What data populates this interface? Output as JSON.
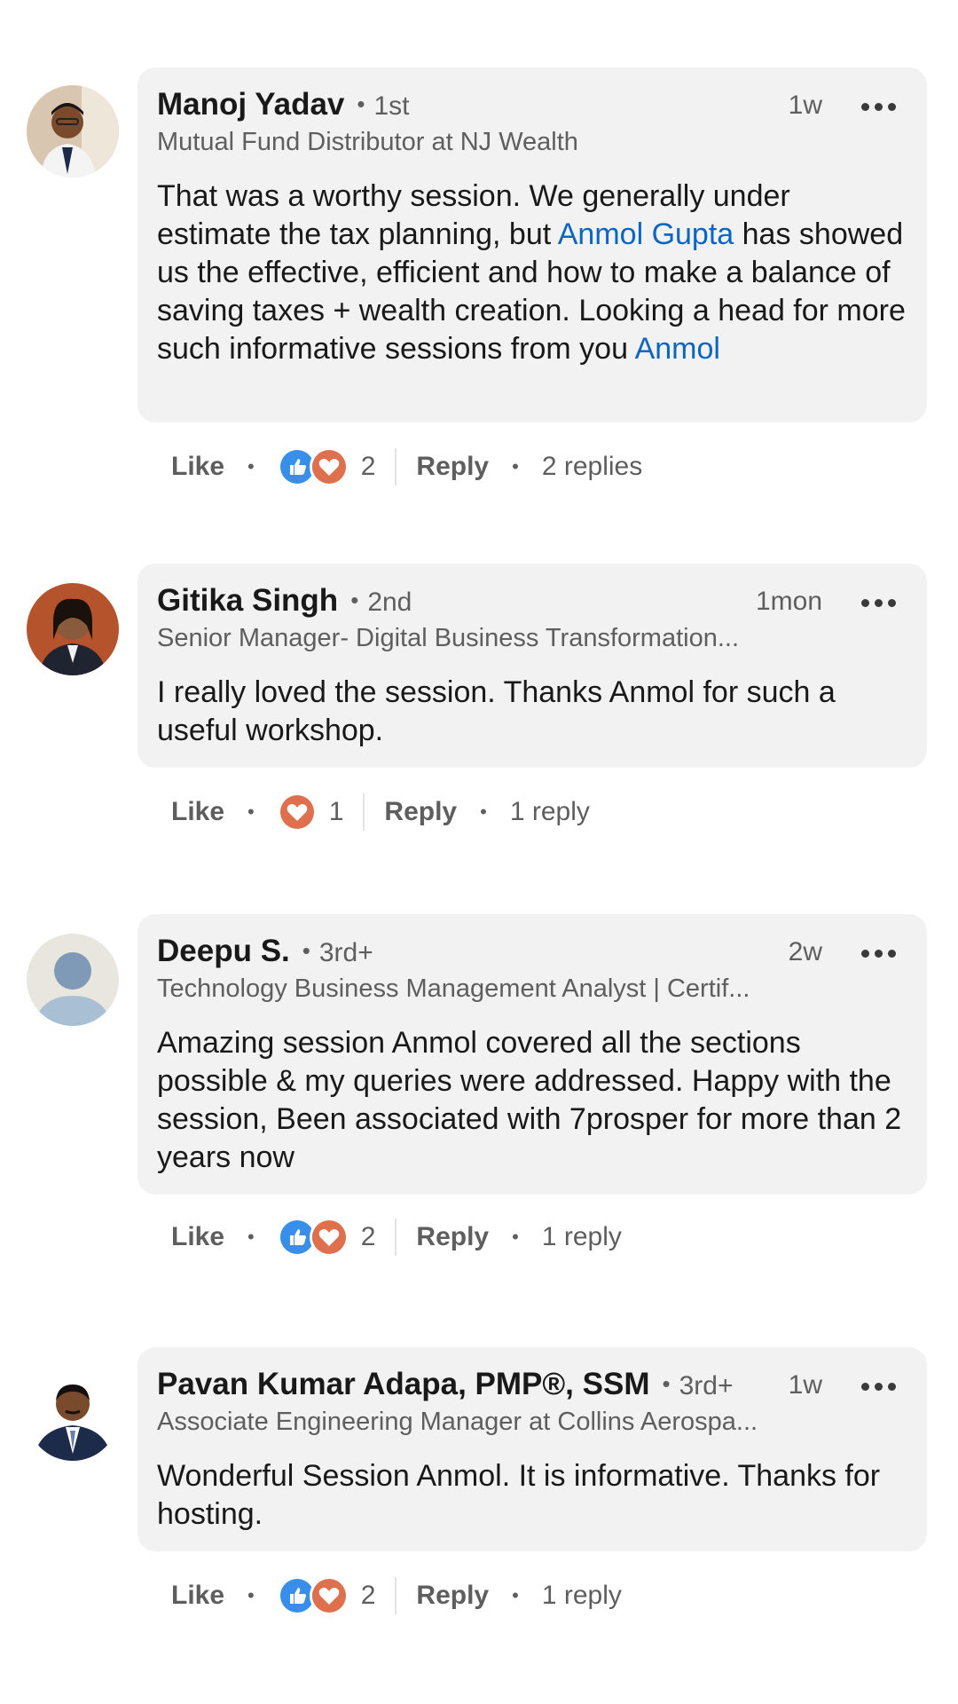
{
  "colors": {
    "link": "#0a66c2",
    "like": "#378fe9",
    "love": "#df704d",
    "bubble": "#f2f2f2"
  },
  "actions_labels": {
    "like": "Like",
    "reply": "Reply"
  },
  "comments": [
    {
      "name": "Manoj Yadav",
      "degree": "1st",
      "time": "1w",
      "headline": "Mutual Fund Distributor at NJ Wealth",
      "body": {
        "t1": "That was a worthy session. We generally under estimate the tax planning, but ",
        "m1": "Anmol Gupta",
        "t2": " has showed us the effective, efficient and how to make a balance of saving taxes + wealth creation. Looking a head for more such informative sessions from you ",
        "m2": "Anmol"
      },
      "reactions": [
        "like-icon",
        "love-icon"
      ],
      "reaction_count": "2",
      "replies": "2 replies",
      "avatar": "profile-photo"
    },
    {
      "name": "Gitika Singh",
      "degree": "2nd",
      "time": "1mon",
      "headline": "Senior Manager- Digital Business Transformation...",
      "body": {
        "text": "I really loved the session. Thanks Anmol for such a useful workshop."
      },
      "reactions": [
        "love-icon"
      ],
      "reaction_count": "1",
      "replies": "1 reply",
      "avatar": "profile-photo"
    },
    {
      "name": "Deepu S.",
      "degree": "3rd+",
      "time": "2w",
      "headline": "Technology Business Management Analyst | Certif...",
      "body": {
        "text": "Amazing session Anmol covered all the sections possible & my queries were addressed. Happy with the session, Been associated with 7prosper for more than 2 years now"
      },
      "reactions": [
        "like-icon",
        "love-icon"
      ],
      "reaction_count": "2",
      "replies": "1 reply",
      "avatar": "default-avatar"
    },
    {
      "name": "Pavan Kumar Adapa, PMP®, SSM",
      "degree": "3rd+",
      "time": "1w",
      "headline": "Associate Engineering Manager at Collins Aerospa...",
      "body": {
        "text": "Wonderful Session Anmol. It is informative. Thanks for hosting."
      },
      "reactions": [
        "like-icon",
        "love-icon"
      ],
      "reaction_count": "2",
      "replies": "1 reply",
      "avatar": "profile-photo"
    }
  ]
}
